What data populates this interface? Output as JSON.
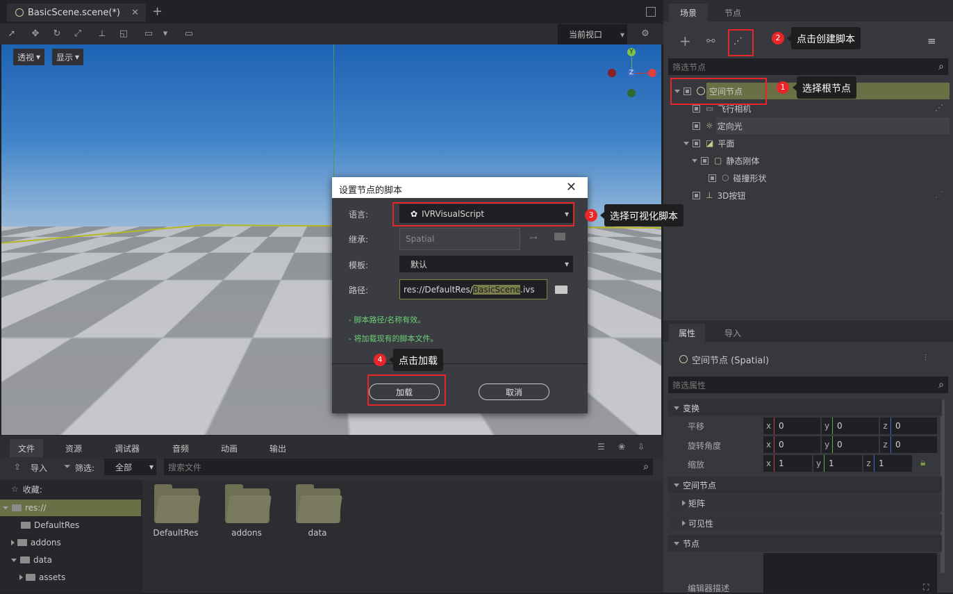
{
  "scene_tab": {
    "title": "BasicScene.scene(*)",
    "close": "✕",
    "add": "+"
  },
  "toolbar": {
    "viewport_select": "当前视口"
  },
  "viewport": {
    "perspective_btn": "透视",
    "display_btn": "显示",
    "gizmo": {
      "y": "Y",
      "z": "Z"
    }
  },
  "dialog": {
    "title": "设置节点的脚本",
    "language_label": "语言:",
    "language_value": "IVRVisualScript",
    "inherit_label": "继承:",
    "inherit_value": "Spatial",
    "template_label": "模板:",
    "template_value": "默认",
    "path_label": "路径:",
    "path_prefix": "res://DefaultRes/",
    "path_highlight": "BasicScene",
    "path_suffix": ".ivs",
    "msg1": "- 脚本路径/名称有效。",
    "msg2": "- 将加载现有的脚本文件。",
    "load_btn": "加载",
    "cancel_btn": "取消"
  },
  "annotations": [
    {
      "num": "1",
      "text": "选择根节点"
    },
    {
      "num": "2",
      "text": "点击创建脚本"
    },
    {
      "num": "3",
      "text": "选择可视化脚本"
    },
    {
      "num": "4",
      "text": "点击加载"
    }
  ],
  "bottom": {
    "tabs": [
      "文件",
      "资源",
      "调试器",
      "音频",
      "动画",
      "输出"
    ],
    "import_btn": "导入",
    "filter_label": "筛选:",
    "filter_value": "全部",
    "search_placeholder": "搜索文件",
    "favorites": "收藏:",
    "tree": [
      "res://",
      "DefaultRes",
      "addons",
      "data",
      "assets"
    ],
    "folders": [
      "DefaultRes",
      "addons",
      "data"
    ]
  },
  "scene_panel": {
    "tabs": [
      "场景",
      "节点"
    ],
    "filter_placeholder": "筛选节点",
    "nodes": [
      "空间节点",
      "飞行相机",
      "定向光",
      "平面",
      "静态刚体",
      "碰撞形状",
      "3D按钮"
    ]
  },
  "inspector": {
    "tabs": [
      "属性",
      "导入"
    ],
    "node_title": "空间节点 (Spatial)",
    "filter_placeholder": "筛选属性",
    "section_transform": "变换",
    "translation_label": "平移",
    "rotation_label": "旋转角度",
    "scale_label": "缩放",
    "translation": {
      "x": "0",
      "y": "0",
      "z": "0"
    },
    "rotation": {
      "x": "0",
      "y": "0",
      "z": "0"
    },
    "scale": {
      "x": "1",
      "y": "1",
      "z": "1"
    },
    "axes": {
      "x": "x",
      "y": "y",
      "z": "z"
    },
    "section_spatial": "空间节点",
    "matrix": "矩阵",
    "visibility": "可见性",
    "section_node": "节点",
    "editor_desc": "编辑器描述"
  },
  "colors": {
    "accent_red": "#e8262a",
    "selected_olive": "#6b6f45",
    "valid_green": "#6cd07a"
  }
}
